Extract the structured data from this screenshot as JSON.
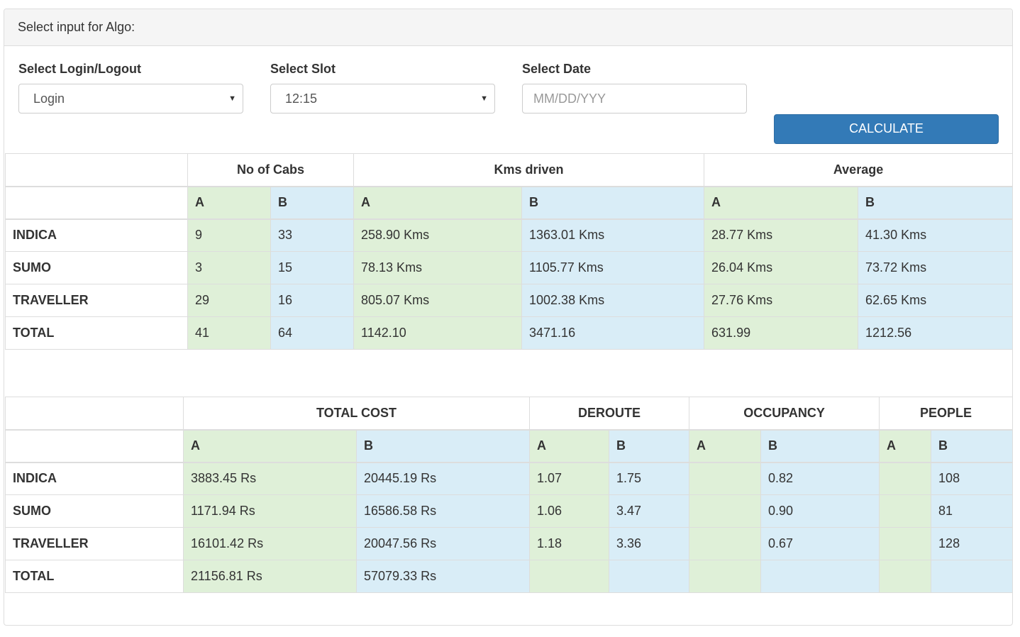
{
  "panel": {
    "heading": "Select input for Algo:"
  },
  "form": {
    "login_label": "Select Login/Logout",
    "login_value": "Login",
    "slot_label": "Select Slot",
    "slot_value": "12:15",
    "date_label": "Select Date",
    "date_placeholder": "MM/DD/YYY",
    "date_value": "",
    "calculate_label": "CALCULATE"
  },
  "table1": {
    "groups": [
      "No of Cabs",
      "Kms driven",
      "Average"
    ],
    "sub": [
      "A",
      "B"
    ],
    "rows": [
      {
        "label": "INDICA",
        "cells": [
          "9",
          "33",
          "258.90 Kms",
          "1363.01 Kms",
          "28.77 Kms",
          "41.30 Kms"
        ]
      },
      {
        "label": "SUMO",
        "cells": [
          "3",
          "15",
          "78.13 Kms",
          "1105.77 Kms",
          "26.04 Kms",
          "73.72 Kms"
        ]
      },
      {
        "label": "TRAVELLER",
        "cells": [
          "29",
          "16",
          "805.07 Kms",
          "1002.38 Kms",
          "27.76 Kms",
          "62.65 Kms"
        ]
      },
      {
        "label": "TOTAL",
        "cells": [
          "41",
          "64",
          "1142.10",
          "3471.16",
          "631.99",
          "1212.56"
        ]
      }
    ]
  },
  "table2": {
    "groups": [
      "TOTAL COST",
      "DEROUTE",
      "OCCUPANCY",
      "PEOPLE"
    ],
    "sub": [
      "A",
      "B"
    ],
    "rows": [
      {
        "label": "INDICA",
        "cells": [
          "3883.45 Rs",
          "20445.19 Rs",
          "1.07",
          "1.75",
          "",
          "0.82",
          "",
          "108"
        ]
      },
      {
        "label": "SUMO",
        "cells": [
          "1171.94 Rs",
          "16586.58 Rs",
          "1.06",
          "3.47",
          "",
          "0.90",
          "",
          "81"
        ]
      },
      {
        "label": "TRAVELLER",
        "cells": [
          "16101.42 Rs",
          "20047.56 Rs",
          "1.18",
          "3.36",
          "",
          "0.67",
          "",
          "128"
        ]
      },
      {
        "label": "TOTAL",
        "cells": [
          "21156.81 Rs",
          "57079.33 Rs",
          "",
          "",
          "",
          "",
          "",
          ""
        ]
      }
    ]
  }
}
